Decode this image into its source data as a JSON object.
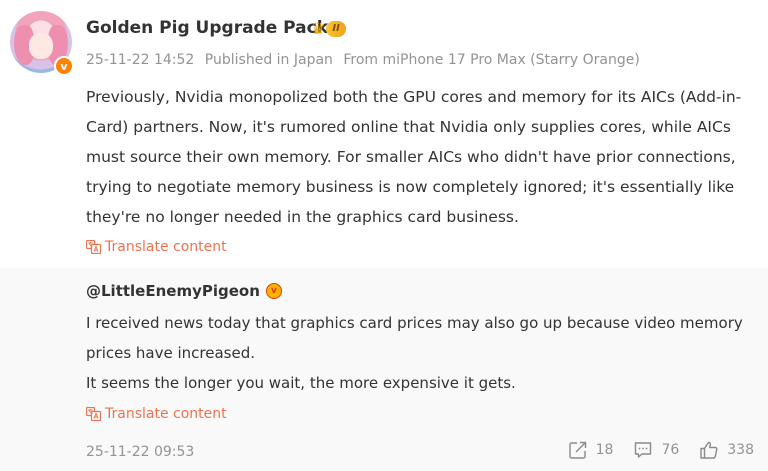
{
  "post": {
    "username": "Golden Pig Upgrade Pack",
    "level_badge": "II",
    "verify_mark": "v",
    "meta": {
      "timestamp": "25-11-22 14:52",
      "location": "Published in Japan",
      "source": "From miPhone 17 Pro Max (Starry Orange)"
    },
    "text": "Previously, Nvidia monopolized both the GPU cores and memory for its AICs (Add-in-Card) partners. Now, it's rumored online that Nvidia only supplies cores, while AICs must source their own memory. For smaller AICs who didn't have prior connections, trying to negotiate memory business is now completely ignored; it's essentially like they're no longer needed in the graphics card business.",
    "translate_label": "Translate content"
  },
  "comment": {
    "author": "@LittleEnemyPigeon",
    "author_badge": "v",
    "lines": [
      "I received news today that graphics card prices may also go up because video memory prices have increased.",
      "It seems the longer you wait, the more expensive it gets."
    ],
    "translate_label": "Translate content",
    "date": "25-11-22 09:53",
    "actions": {
      "share_count": "18",
      "comment_count": "76",
      "like_count": "338"
    }
  },
  "colors": {
    "accent_link": "#eb7350",
    "meta_gray": "#939393",
    "verify_orange": "#ff8200",
    "comment_bg": "#f9f9f9"
  },
  "icons": {
    "translate": "translate-icon",
    "share": "share-icon",
    "comment": "comment-icon",
    "like": "thumbs-up-icon"
  }
}
